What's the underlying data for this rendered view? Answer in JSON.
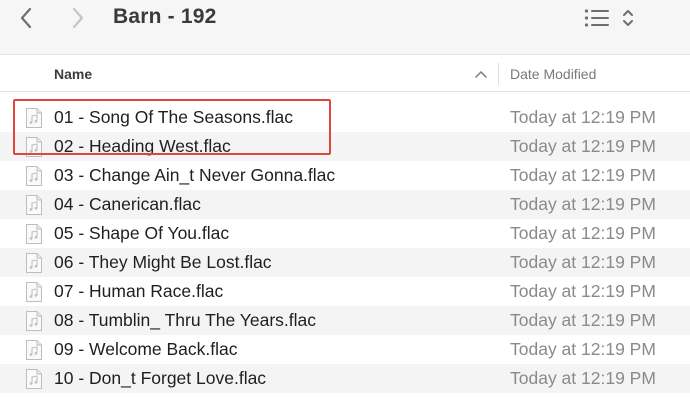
{
  "window": {
    "title": "Barn - 192"
  },
  "toolbar": {
    "back_icon": "chevron-left-icon",
    "forward_icon": "chevron-right-icon",
    "view_icon": "list-view-icon",
    "view_options_icon": "up-down-chevron-icon"
  },
  "columns": {
    "name": "Name",
    "date": "Date Modified",
    "sort_icon": "chevron-up-icon"
  },
  "files": [
    {
      "name": "01 - Song Of The Seasons.flac",
      "date": "Today at 12:19 PM"
    },
    {
      "name": "02 - Heading West.flac",
      "date": "Today at 12:19 PM"
    },
    {
      "name": "03 - Change Ain_t Never Gonna.flac",
      "date": "Today at 12:19 PM"
    },
    {
      "name": "04 - Canerican.flac",
      "date": "Today at 12:19 PM"
    },
    {
      "name": "05 - Shape Of You.flac",
      "date": "Today at 12:19 PM"
    },
    {
      "name": "06 - They Might Be Lost.flac",
      "date": "Today at 12:19 PM"
    },
    {
      "name": "07 - Human Race.flac",
      "date": "Today at 12:19 PM"
    },
    {
      "name": "08 - Tumblin_ Thru The Years.flac",
      "date": "Today at 12:19 PM"
    },
    {
      "name": "09 - Welcome Back.flac",
      "date": "Today at 12:19 PM"
    },
    {
      "name": "10 - Don_t Forget Love.flac",
      "date": "Today at 12:19 PM"
    }
  ],
  "colors": {
    "highlight": "#e2463b",
    "stripe": "#f4f4f4",
    "date_text": "#8a8a8a"
  }
}
